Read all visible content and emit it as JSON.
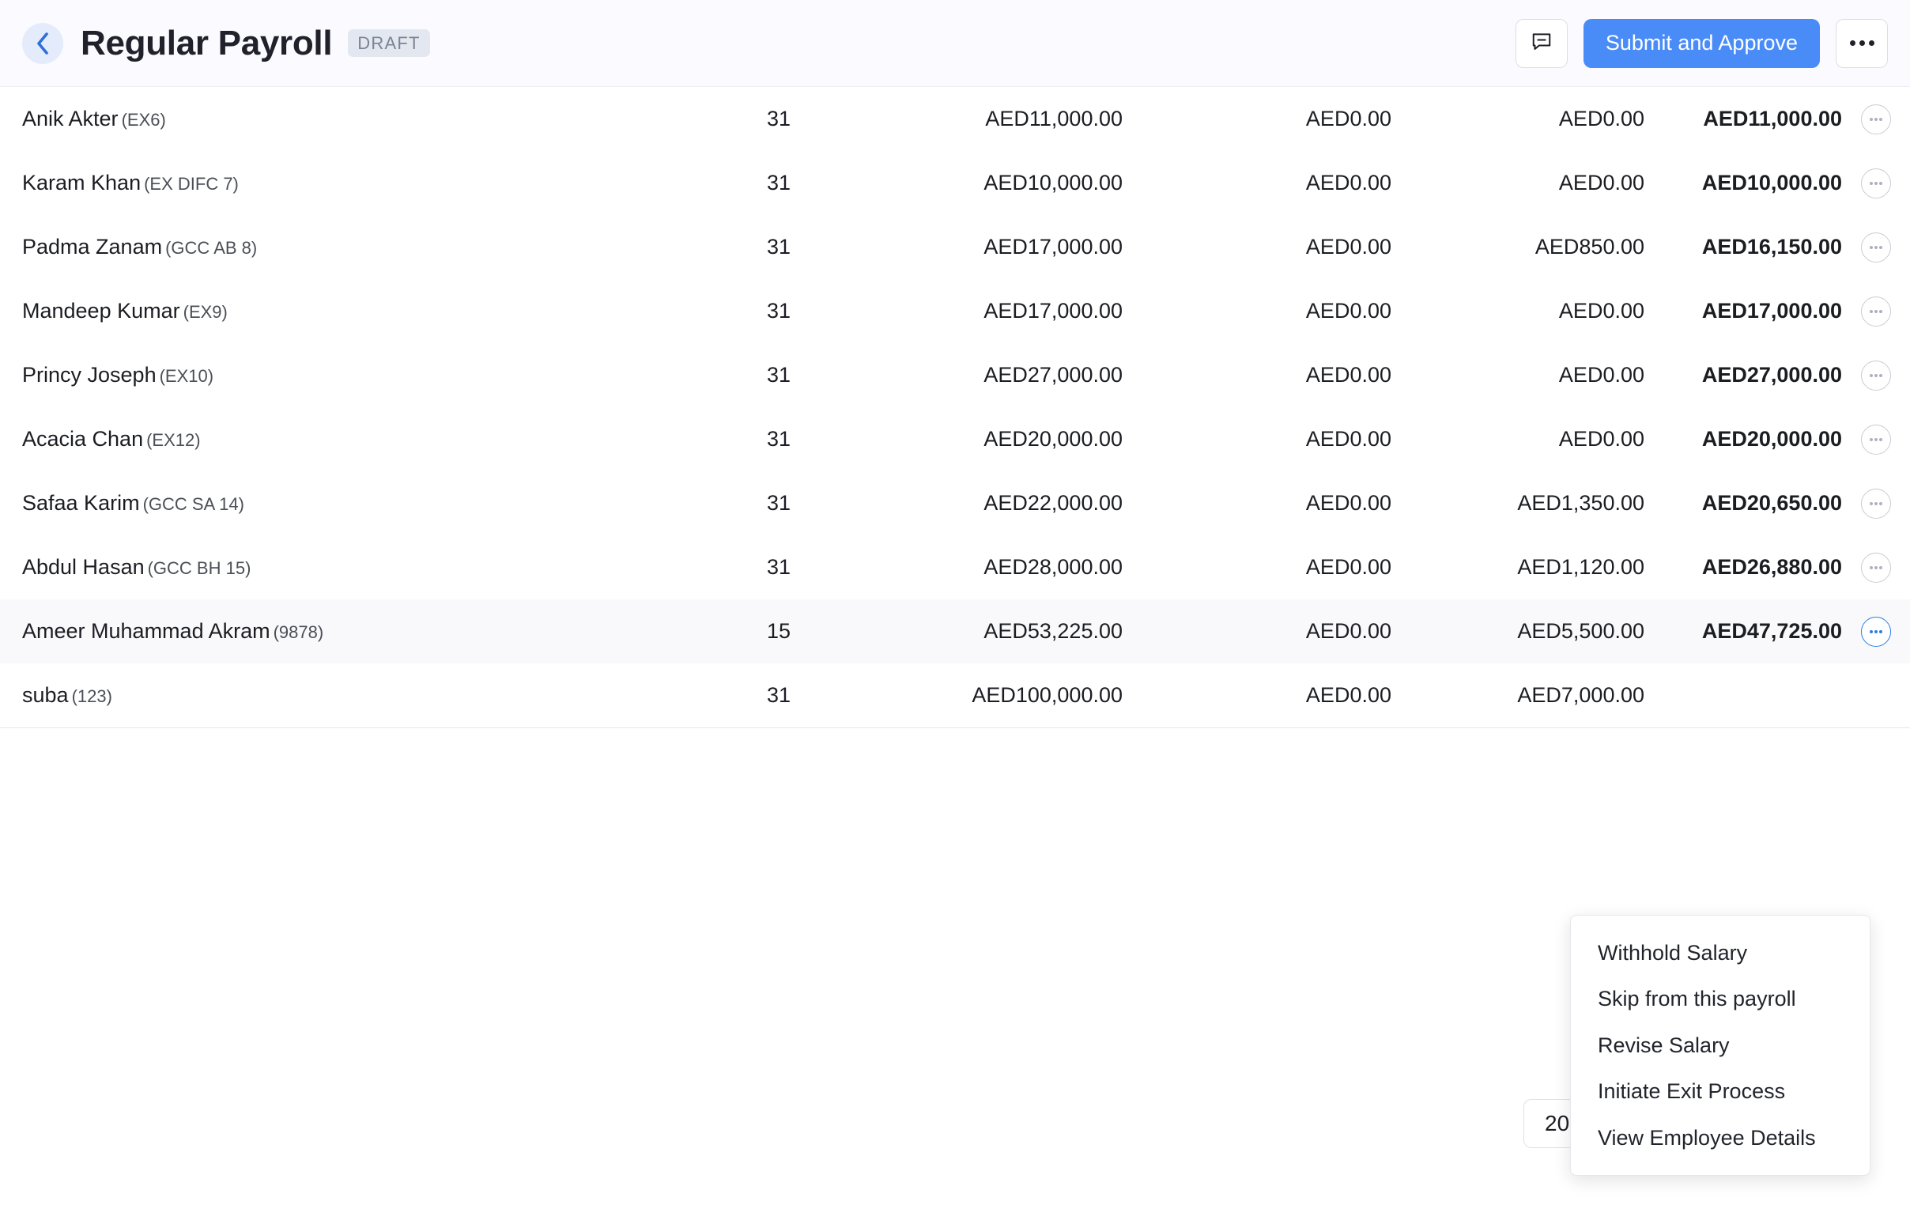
{
  "header": {
    "back_icon": "chevron-left-icon",
    "title": "Regular Payroll",
    "status": "DRAFT",
    "comment_icon": "comment-minus-icon",
    "submit_label": "Submit and Approve",
    "overflow_icon": "ellipsis-horizontal-icon",
    "accent_color": "#4a8cf7",
    "background_color": "#fafaff",
    "badge_bg_color": "#e3e7ef",
    "badge_text_color": "#7b8496"
  },
  "table": {
    "rows": [
      {
        "name": "Anik Akter",
        "code": "(EX6)",
        "days": "31",
        "gross": "AED11,000.00",
        "additions": "AED0.00",
        "deductions": "AED0.00",
        "net": "AED11,000.00",
        "menu_icon": "row-ellipsis-icon"
      },
      {
        "name": "Karam Khan",
        "code": "(EX DIFC 7)",
        "days": "31",
        "gross": "AED10,000.00",
        "additions": "AED0.00",
        "deductions": "AED0.00",
        "net": "AED10,000.00",
        "menu_icon": "row-ellipsis-icon"
      },
      {
        "name": "Padma Zanam",
        "code": "(GCC AB 8)",
        "days": "31",
        "gross": "AED17,000.00",
        "additions": "AED0.00",
        "deductions": "AED850.00",
        "net": "AED16,150.00",
        "menu_icon": "row-ellipsis-icon"
      },
      {
        "name": "Mandeep Kumar",
        "code": "(EX9)",
        "days": "31",
        "gross": "AED17,000.00",
        "additions": "AED0.00",
        "deductions": "AED0.00",
        "net": "AED17,000.00",
        "menu_icon": "row-ellipsis-icon"
      },
      {
        "name": "Princy Joseph",
        "code": "(EX10)",
        "days": "31",
        "gross": "AED27,000.00",
        "additions": "AED0.00",
        "deductions": "AED0.00",
        "net": "AED27,000.00",
        "menu_icon": "row-ellipsis-icon"
      },
      {
        "name": "Acacia Chan",
        "code": "(EX12)",
        "days": "31",
        "gross": "AED20,000.00",
        "additions": "AED0.00",
        "deductions": "AED0.00",
        "net": "AED20,000.00",
        "menu_icon": "row-ellipsis-icon"
      },
      {
        "name": "Safaa Karim",
        "code": "(GCC SA 14)",
        "days": "31",
        "gross": "AED22,000.00",
        "additions": "AED0.00",
        "deductions": "AED1,350.00",
        "net": "AED20,650.00",
        "menu_icon": "row-ellipsis-icon"
      },
      {
        "name": "Abdul Hasan",
        "code": "(GCC BH 15)",
        "days": "31",
        "gross": "AED28,000.00",
        "additions": "AED0.00",
        "deductions": "AED1,120.00",
        "net": "AED26,880.00",
        "menu_icon": "row-ellipsis-icon"
      },
      {
        "name": "Ameer Muhammad Akram",
        "code": "(9878)",
        "days": "15",
        "gross": "AED53,225.00",
        "additions": "AED0.00",
        "deductions": "AED5,500.00",
        "net": "AED47,725.00",
        "menu_icon": "row-ellipsis-icon"
      },
      {
        "name": "suba",
        "code": "(123)",
        "days": "31",
        "gross": "AED100,000.00",
        "additions": "AED0.00",
        "deductions": "AED7,000.00",
        "net": "",
        "menu_icon": "row-ellipsis-icon"
      }
    ]
  },
  "pagination": {
    "page_size": "20"
  },
  "context_menu": {
    "items": [
      "Withhold Salary",
      "Skip from this payroll",
      "Revise Salary",
      "Initiate Exit Process",
      "View Employee Details"
    ]
  }
}
